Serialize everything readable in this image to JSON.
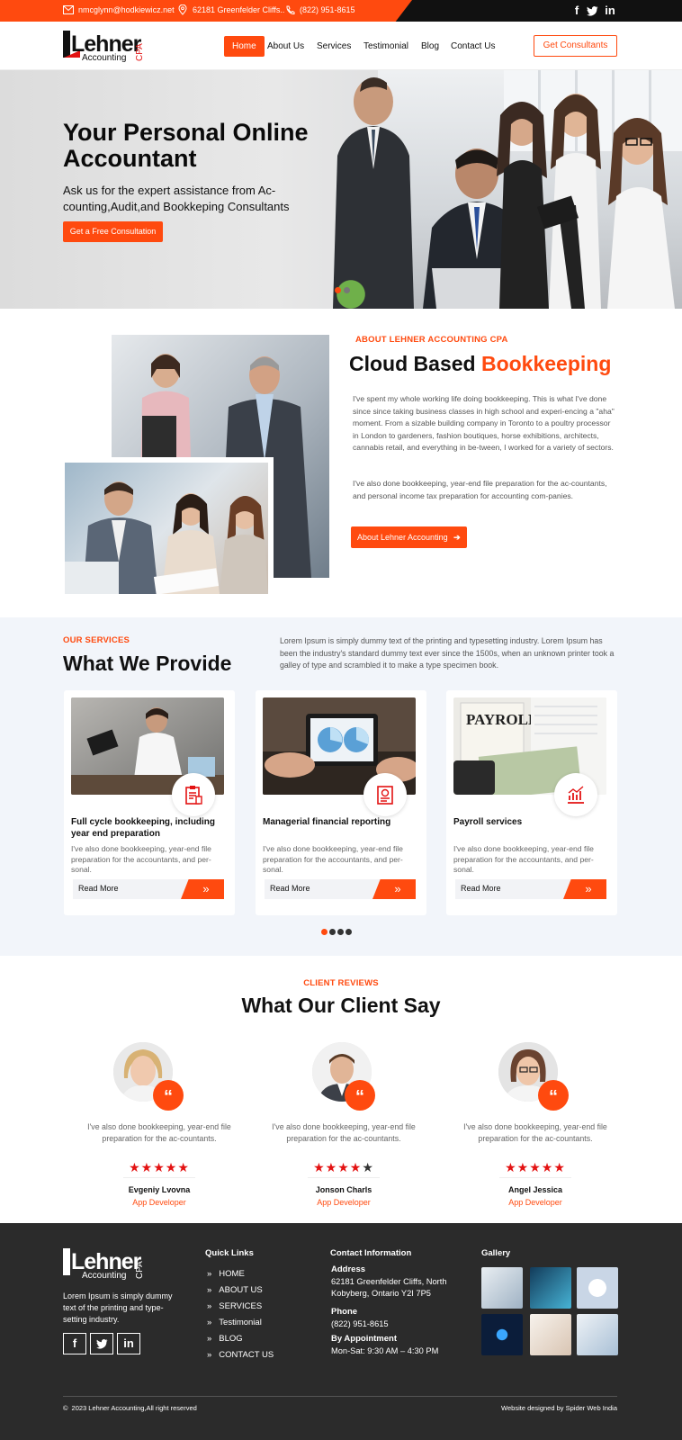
{
  "topbar": {
    "email": "nmcglynn@hodkiewicz.net",
    "address": "62181 Greenfelder Cliffs..",
    "phone": "(822) 951-8615",
    "social": [
      "f",
      "t",
      "in"
    ]
  },
  "brand": {
    "name": "Lehner",
    "sub": "Accounting",
    "tag": "CPA"
  },
  "nav": {
    "items": [
      "Home",
      "About Us",
      "Services",
      "Testimonial",
      "Blog",
      "Contact Us"
    ],
    "active": "Home",
    "cta": "Get Consultants"
  },
  "hero": {
    "title_line1": "Your Personal Online",
    "title_line2": "Accountant",
    "subtitle": "Ask us for the expert assistance from Ac-counting,Audit,and Bookkeping Consultants",
    "button": "Get a Free Consultation"
  },
  "about": {
    "label": "ABOUT LEHNER ACCOUNTING CPA",
    "title_plain": "Cloud Based",
    "title_accent": "Bookkeeping",
    "p1": "I've spent my whole working life doing bookkeeping. This is what I've done since since taking business classes in high school and experi-encing a \"aha\" moment. From a sizable building company in Toronto to a poultry processor in London to gardeners, fashion boutiques, horse exhibitions, architects, cannabis retail, and everything in be-tween, I worked for a variety of sectors.",
    "p2": "I've also done bookkeeping, year-end file preparation for the ac-countants, and personal income tax preparation for accounting com-panies.",
    "button": "About Lehner Accounting"
  },
  "services": {
    "label": "OUR SERVICES",
    "title": "What We Provide",
    "intro": "Lorem Ipsum is simply dummy text of the printing and typesetting industry. Lorem Ipsum has been the industry's standard dummy text ever since the 1500s, when an unknown printer took a galley of type and scrambled it to make a type specimen book.",
    "cards": [
      {
        "title": "Full cycle bookkeeping, including year end preparation",
        "text": "I've also done bookkeeping, year-end file preparation for the accountants, and per-sonal.",
        "more": "Read More",
        "icon": "clipboard-icon"
      },
      {
        "title": "Managerial financial reporting",
        "text": "I've also done bookkeeping, year-end file preparation for the accountants, and per-sonal.",
        "more": "Read More",
        "icon": "report-icon"
      },
      {
        "title": "Payroll services",
        "text": "I've also done bookkeeping, year-end file preparation for the accountants, and per-sonal.",
        "more": "Read More",
        "icon": "chart-icon"
      }
    ],
    "pager_active": 0,
    "pager_count": 4
  },
  "reviews": {
    "label": "CLIENT REVIEWS",
    "title": "What Our Client Say",
    "items": [
      {
        "text": "I've also done bookkeeping, year-end file preparation for the ac-countants.",
        "rating": 5,
        "name": "Evgeniy Lvovna",
        "role": "App Developer"
      },
      {
        "text": "I've also done bookkeeping, year-end file preparation for the ac-countants.",
        "rating": 4,
        "name": "Jonson Charls",
        "role": "App Developer"
      },
      {
        "text": "I've also done bookkeeping, year-end file preparation for the ac-countants.",
        "rating": 5,
        "name": "Angel Jessica",
        "role": "App Developer"
      }
    ]
  },
  "footer": {
    "about": "Lorem Ipsum is simply dummy text of the printing and type-setting industry.",
    "quick_links_title": "Quick Links",
    "quick_links": [
      "HOME",
      "ABOUT US",
      "SERVICES",
      "Testimonial",
      "BLOG",
      "CONTACT US"
    ],
    "contact_title": "Contact Information",
    "address_label": "Address",
    "address": "62181 Greenfelder Cliffs, North Kobyberg, Ontario Y2I 7P5",
    "phone_label": "Phone",
    "phone": "(822) 951-8615",
    "appt_label": "By Appointment",
    "hours": "Mon-Sat: 9:30 AM – 4:30 PM",
    "gallery_title": "Gallery",
    "copyright": "2023 Lehner Accounting,All right reserved",
    "credit": "Website designed by Spider Web India"
  },
  "colors": {
    "accent": "#ff4a0f",
    "dark": "#2b2b2b",
    "section_bg": "#f2f5fa"
  }
}
